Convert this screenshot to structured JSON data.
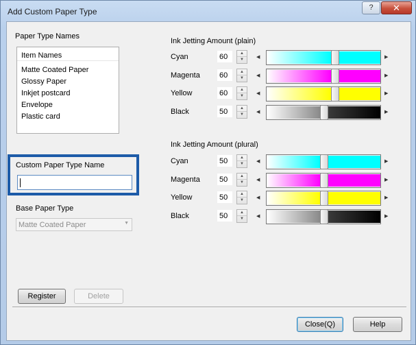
{
  "window": {
    "title": "Add Custom Paper Type",
    "help_glyph": "?",
    "close_glyph": "✕"
  },
  "paper_type_names": {
    "label": "Paper Type Names",
    "header": "Item Names",
    "items": [
      "Matte Coated Paper",
      "Glossy Paper",
      "Inkjet postcard",
      "Envelope",
      "Plastic card"
    ]
  },
  "custom_name": {
    "label": "Custom Paper Type Name",
    "value": ""
  },
  "base_paper": {
    "label": "Base Paper Type",
    "selected": "Matte Coated Paper"
  },
  "ink_plain": {
    "title": "Ink Jetting Amount (plain)",
    "channels": [
      {
        "name": "Cyan",
        "value": "60",
        "level": 60,
        "color": "#00ffff"
      },
      {
        "name": "Magenta",
        "value": "60",
        "level": 60,
        "color": "#ff00ff"
      },
      {
        "name": "Yellow",
        "value": "60",
        "level": 60,
        "color": "#ffff00"
      },
      {
        "name": "Black",
        "value": "50",
        "level": 50,
        "color": "#000000"
      }
    ]
  },
  "ink_plural": {
    "title": "Ink Jetting Amount (plural)",
    "channels": [
      {
        "name": "Cyan",
        "value": "50",
        "level": 50,
        "color": "#00ffff"
      },
      {
        "name": "Magenta",
        "value": "50",
        "level": 50,
        "color": "#ff00ff"
      },
      {
        "name": "Yellow",
        "value": "50",
        "level": 50,
        "color": "#ffff00"
      },
      {
        "name": "Black",
        "value": "50",
        "level": 50,
        "color": "#000000"
      }
    ]
  },
  "buttons": {
    "register": "Register",
    "delete": "Delete",
    "close": "Close(Q)",
    "help": "Help"
  },
  "colors": {
    "highlight_border": "#1d5ba8"
  }
}
